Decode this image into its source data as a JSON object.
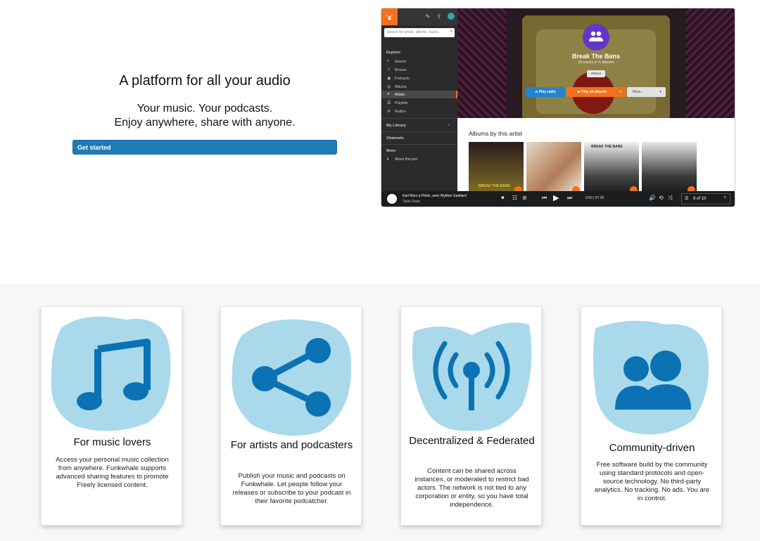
{
  "hero": {
    "title": "A platform for all your audio",
    "subtitle_line1": "Your music. Your podcasts.",
    "subtitle_line2": "Enjoy anywhere, share with anyone.",
    "cta_label": "Get started"
  },
  "app": {
    "search_placeholder": "Search for artists, albums, tracks...",
    "nav": {
      "explore_label": "Explore",
      "items": [
        {
          "label": "Search",
          "icon": "search-icon"
        },
        {
          "label": "Browse",
          "icon": "music-note-icon"
        },
        {
          "label": "Podcasts",
          "icon": "podcast-icon"
        },
        {
          "label": "Albums",
          "icon": "disc-icon"
        },
        {
          "label": "Artists",
          "icon": "user-icon",
          "active": true
        },
        {
          "label": "Playlists",
          "icon": "list-icon"
        },
        {
          "label": "Radios",
          "icon": "feed-icon"
        }
      ],
      "my_library_label": "My Library",
      "channels_label": "Channels",
      "more_label": "More",
      "about_label": "About this pod"
    },
    "artist": {
      "name": "Break The Bans",
      "meta": "25 tracks in 6 albums",
      "tag": "#Bbest",
      "play_radio": "Play radio",
      "play_all": "Play all albums",
      "more": "More..."
    },
    "albums_heading": "Albums by this artist",
    "album_labels": [
      "BREAK THE BANS",
      "BREAK THE BANS"
    ],
    "player": {
      "track": "Karl Marx à Pékin, avec Mylène Gasbard",
      "album": "Table Rase",
      "time": "0:00 | 57:35",
      "queue": "9 of 10"
    }
  },
  "features": [
    {
      "title": "For music lovers",
      "text": "Access your personal music collection from anywhere. Funkwhale supports advanced sharing features to promote Freely licensed content.",
      "icon": "music-note-icon"
    },
    {
      "title": "For artists and podcasters",
      "text": "Publish your music and podcasts on Funkwhale. Let people follow your releases or subscribe to your podcast in their favorite podcatcher.",
      "icon": "share-icon"
    },
    {
      "title": "Decentralized & Federated",
      "text": "Content can be shared across instances, or moderated to restrict bad actors. The network is not tied to any corporation or entity, so you have total independence.",
      "icon": "broadcast-icon"
    },
    {
      "title": "Community-driven",
      "text": "Free software build by the community using standard protocols and open-source technology. No third-party analytics. No tracking. No ads. You are in control.",
      "icon": "users-icon"
    }
  ],
  "colors": {
    "brand_blue": "#1f7ab6",
    "icon_blue": "#0b72b3",
    "blob_blue": "#a9d9ea",
    "orange": "#f2711c",
    "purple": "#6435c9"
  }
}
